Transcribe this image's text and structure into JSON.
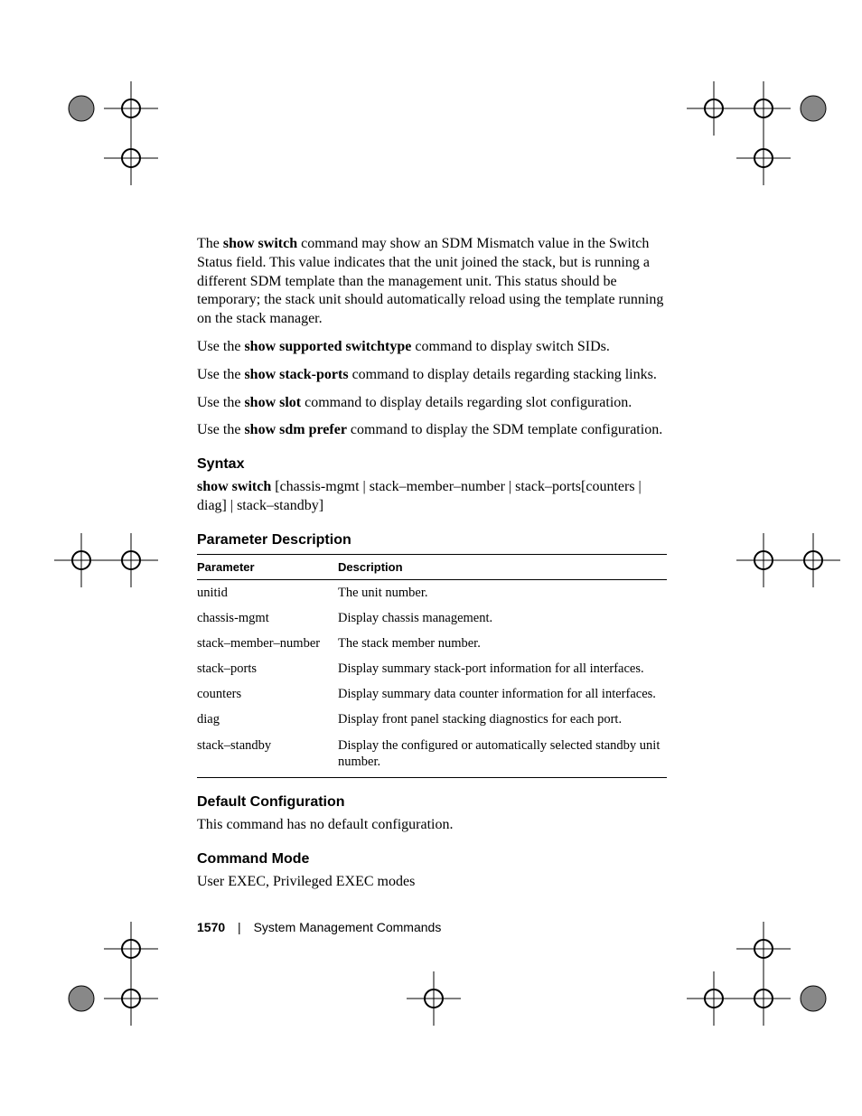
{
  "intro": {
    "p1_pre": "The ",
    "p1_b": "show switch",
    "p1_post": " command may show an SDM Mismatch value in the Switch Status field. This value indicates that the unit joined the stack, but is running a different SDM template than the management unit. This status should be temporary; the stack unit should automatically reload using the template running on the stack manager.",
    "p2_pre": "Use the ",
    "p2_b": "show supported switchtype",
    "p2_post": " command to display switch SIDs.",
    "p3_pre": "Use the ",
    "p3_b": "show stack-ports",
    "p3_post": " command to display details regarding stacking links.",
    "p4_pre": "Use the ",
    "p4_b": "show slot",
    "p4_post": " command to display details regarding slot configuration.",
    "p5_pre": "Use the ",
    "p5_b": "show sdm prefer",
    "p5_post": " command to display the SDM template configuration."
  },
  "syntax": {
    "heading": "Syntax",
    "cmd_b": "show switch",
    "cmd_rest": " [chassis-mgmt | stack–member–number | stack–ports[counters | diag] | stack–standby]"
  },
  "param_section": {
    "heading": "Parameter Description",
    "th_param": "Parameter",
    "th_desc": "Description",
    "rows": [
      {
        "p": "unitid",
        "d": "The unit number."
      },
      {
        "p": "chassis-mgmt",
        "d": "Display chassis management."
      },
      {
        "p": "stack–member–number",
        "d": "The stack member number."
      },
      {
        "p": "stack–ports",
        "d": "Display summary stack-port information for all interfaces."
      },
      {
        "p": "counters",
        "d": "Display summary data counter information for all interfaces."
      },
      {
        "p": "diag",
        "d": "Display front panel stacking diagnostics for each port."
      },
      {
        "p": "stack–standby",
        "d": "Display the configured or automatically selected standby unit number."
      }
    ]
  },
  "default_cfg": {
    "heading": "Default Configuration",
    "text": "This command has no default configuration."
  },
  "cmd_mode": {
    "heading": "Command Mode",
    "text": "User EXEC, Privileged EXEC modes"
  },
  "footer": {
    "page": "1570",
    "section": "System Management Commands"
  }
}
